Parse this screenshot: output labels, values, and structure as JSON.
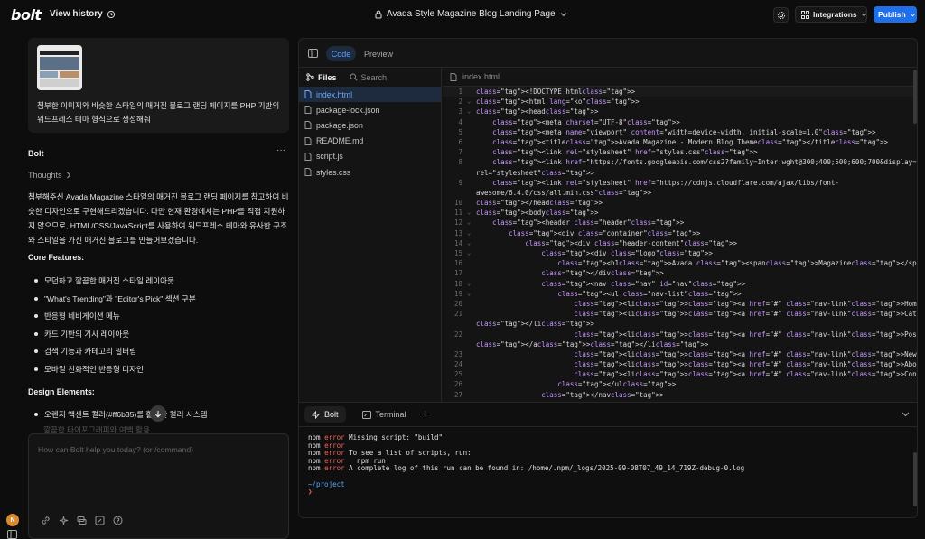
{
  "header": {
    "logo": "bolt",
    "view_history": "View history",
    "project_title": "Avada Style Magazine Blog Landing Page",
    "integrations": "Integrations",
    "publish": "Publish"
  },
  "chat": {
    "user_message": "첨부한 이미지와 비슷한 스타일의 매거진 블로그 랜딩 페이지를 PHP 기반의 워드프레스 테마 형식으로 생성해줘",
    "assistant_name": "Bolt",
    "more": "···",
    "thoughts": "Thoughts",
    "response_intro": "첨부해주신 Avada Magazine 스타일의 매거진 블로그 랜딩 페이지를 참고하여 비슷한 디자인으로 구현해드리겠습니다. 다만 현재 환경에서는 PHP를 직접 지원하지 않으므로, HTML/CSS/JavaScript를 사용하여 워드프레스 테마와 유사한 구조와 스타일을 가진 매거진 블로그를 만들어보겠습니다.",
    "core_features_heading": "Core Features:",
    "core_features": [
      "모던하고 깔끔한 매거진 스타일 레이아웃",
      "\"What's Trending\"과 \"Editor's Pick\" 섹션 구분",
      "반응형 네비게이션 메뉴",
      "카드 기반의 기사 레이아웃",
      "검색 기능과 카테고리 필터링",
      "모바일 친화적인 반응형 디자인"
    ],
    "design_heading": "Design Elements:",
    "design_elements": [
      "오렌지 액센트 컬러(#ff6b35)를 활용한 컬러 시스템"
    ],
    "faded_line": "깔끔한 타이포그래피와 여백 활용",
    "input_placeholder": "How can Bolt help you today? (or /command)",
    "avatar_initial": "N"
  },
  "workbench": {
    "tabs": {
      "code": "Code",
      "preview": "Preview"
    },
    "files_label": "Files",
    "search_label": "Search",
    "files": [
      "index.html",
      "package-lock.json",
      "package.json",
      "README.md",
      "script.js",
      "styles.css"
    ],
    "active_file": "index.html",
    "editor_tab": "index.html",
    "terminal_tabs": {
      "bolt": "Bolt",
      "terminal": "Terminal"
    },
    "terminal_lines": [
      {
        "prefix": "npm",
        "level": "error",
        "text": " Missing script: \"build\""
      },
      {
        "prefix": "npm",
        "level": "error",
        "text": ""
      },
      {
        "prefix": "npm",
        "level": "error",
        "text": " To see a list of scripts, run:"
      },
      {
        "prefix": "npm",
        "level": "error",
        "text": "   npm run"
      },
      {
        "prefix": "npm",
        "level": "error",
        "text": " A complete log of this run can be found in: /home/.npm/_logs/2025-09-08T07_49_14_719Z-debug-0.log"
      }
    ],
    "prompt_path": "~/project",
    "prompt_symbol": "❯"
  },
  "code_lines": [
    {
      "n": "1",
      "fold": "",
      "t": "<!DOCTYPE html>"
    },
    {
      "n": "2",
      "fold": "v",
      "t": "<html lang=\"ko\">"
    },
    {
      "n": "3",
      "fold": "v",
      "t": "<head>"
    },
    {
      "n": "4",
      "fold": "",
      "t": "    <meta charset=\"UTF-8\">"
    },
    {
      "n": "5",
      "fold": "",
      "t": "    <meta name=\"viewport\" content=\"width=device-width, initial-scale=1.0\">"
    },
    {
      "n": "6",
      "fold": "",
      "t": "    <title>Avada Magazine - Modern Blog Theme</title>"
    },
    {
      "n": "7",
      "fold": "",
      "t": "    <link rel=\"stylesheet\" href=\"styles.css\">"
    },
    {
      "n": "8",
      "fold": "",
      "t": "    <link href=\"https://fonts.googleapis.com/css2?family=Inter:wght@300;400;500;600;700&display=swap\""
    },
    {
      "n": "",
      "fold": "",
      "t": "rel=\"stylesheet\">"
    },
    {
      "n": "9",
      "fold": "",
      "t": "    <link rel=\"stylesheet\" href=\"https://cdnjs.cloudflare.com/ajax/libs/font-"
    },
    {
      "n": "",
      "fold": "",
      "t": "awesome/6.4.0/css/all.min.css\">"
    },
    {
      "n": "10",
      "fold": "",
      "t": "</head>"
    },
    {
      "n": "11",
      "fold": "v",
      "t": "<body>"
    },
    {
      "n": "12",
      "fold": "v",
      "t": "    <header class=\"header\">"
    },
    {
      "n": "13",
      "fold": "v",
      "t": "        <div class=\"container\">"
    },
    {
      "n": "14",
      "fold": "v",
      "t": "            <div class=\"header-content\">"
    },
    {
      "n": "15",
      "fold": "v",
      "t": "                <div class=\"logo\">"
    },
    {
      "n": "16",
      "fold": "",
      "t": "                    <h1>Avada <span>Magazine</span></h1>"
    },
    {
      "n": "17",
      "fold": "",
      "t": "                </div>"
    },
    {
      "n": "18",
      "fold": "v",
      "t": "                <nav class=\"nav\" id=\"nav\">"
    },
    {
      "n": "19",
      "fold": "v",
      "t": "                    <ul class=\"nav-list\">"
    },
    {
      "n": "20",
      "fold": "",
      "t": "                        <li><a href=\"#\" class=\"nav-link\">Home <i class=\"fas fa-chevron-down\"></i></a></li>"
    },
    {
      "n": "21",
      "fold": "",
      "t": "                        <li><a href=\"#\" class=\"nav-link\">Categories <i class=\"fas fa-chevron-down\"></i></a>"
    },
    {
      "n": "",
      "fold": "",
      "t": "</li>"
    },
    {
      "n": "22",
      "fold": "",
      "t": "                        <li><a href=\"#\" class=\"nav-link\">Post Styles <i class=\"fas fa-chevron-down\"></i>"
    },
    {
      "n": "",
      "fold": "",
      "t": "</a></li>"
    },
    {
      "n": "23",
      "fold": "",
      "t": "                        <li><a href=\"#\" class=\"nav-link\">News Blog</a></li>"
    },
    {
      "n": "24",
      "fold": "",
      "t": "                        <li><a href=\"#\" class=\"nav-link\">About</a></li>"
    },
    {
      "n": "25",
      "fold": "",
      "t": "                        <li><a href=\"#\" class=\"nav-link\">Contact</a></li>"
    },
    {
      "n": "26",
      "fold": "",
      "t": "                    </ul>"
    },
    {
      "n": "27",
      "fold": "",
      "t": "                </nav>"
    }
  ],
  "colors": {
    "accent": "#1f6feb",
    "active_tab_text": "#5aa0ff",
    "error": "#ff5c5c",
    "avatar": "#d98a2c"
  }
}
